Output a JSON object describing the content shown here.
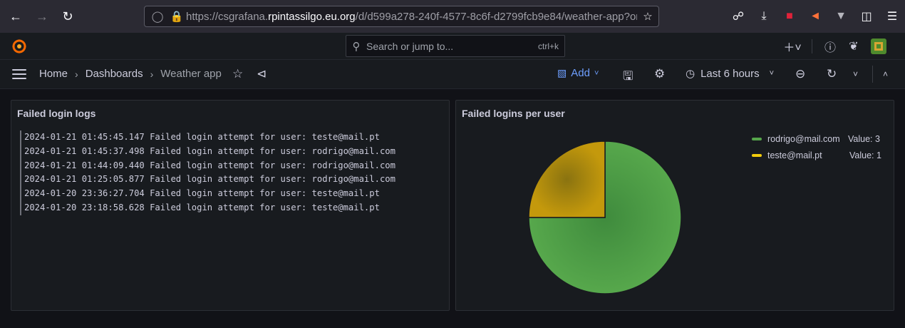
{
  "browser": {
    "url_prefix": "https://csgrafana.",
    "url_host": "rpintassilgo.eu.org",
    "url_path": "/d/d599a278-240f-4577-8c6f-d2799fcb9e84/weather-app?or"
  },
  "topbar": {
    "search_placeholder": "Search or jump to...",
    "search_shortcut": "ctrl+k"
  },
  "breadcrumb": {
    "home": "Home",
    "dashboards": "Dashboards",
    "current": "Weather app"
  },
  "toolbar": {
    "add_label": "Add",
    "time_range": "Last 6 hours"
  },
  "logs_panel": {
    "title": "Failed login logs",
    "lines": [
      "2024-01-21 01:45:45.147 Failed login attempt for user: teste@mail.pt",
      "2024-01-21 01:45:37.498 Failed login attempt for user: rodrigo@mail.com",
      "2024-01-21 01:44:09.440 Failed login attempt for user: rodrigo@mail.com",
      "2024-01-21 01:25:05.877 Failed login attempt for user: rodrigo@mail.com",
      "2024-01-20 23:36:27.704 Failed login attempt for user: teste@mail.pt",
      "2024-01-20 23:18:58.628 Failed login attempt for user: teste@mail.pt"
    ]
  },
  "pie_panel": {
    "title": "Failed logins per user",
    "legend": [
      {
        "name": "rodrigo@mail.com",
        "value_text": "Value: 3"
      },
      {
        "name": "teste@mail.pt",
        "value_text": "Value: 1"
      }
    ]
  },
  "chart_data": {
    "type": "pie",
    "title": "Failed logins per user",
    "series": [
      {
        "name": "rodrigo@mail.com",
        "value": 3,
        "color": "#56a64b"
      },
      {
        "name": "teste@mail.pt",
        "value": 1,
        "color": "#f2cc0c"
      }
    ],
    "legend_position": "top-right"
  },
  "colors": {
    "accent": "#6e9fff",
    "rodrigo": "#56a64b",
    "teste": "#f2cc0c",
    "teste_fill": "#c4950c"
  }
}
